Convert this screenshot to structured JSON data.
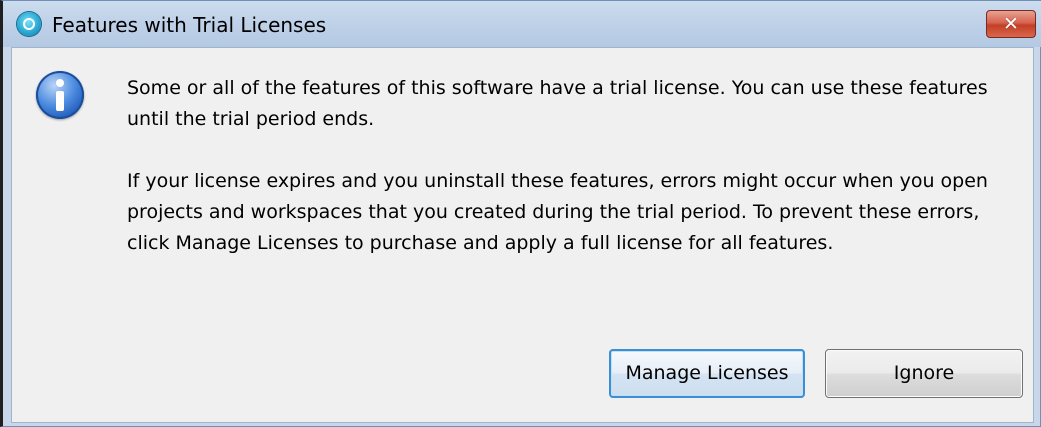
{
  "window": {
    "title": "Features with Trial Licenses",
    "close_label": "✕"
  },
  "message": {
    "paragraph1": "Some or all of the features of this software have a trial license.  You can use these features until the trial period ends.",
    "paragraph2": "If your license expires and you uninstall these features, errors might occur when you open projects and workspaces that you created during the trial period.  To prevent these errors, click Manage Licenses to purchase and apply a full license for all features."
  },
  "buttons": {
    "manage_label": "Manage Licenses",
    "ignore_label": "Ignore"
  },
  "icons": {
    "app": "app-logo-icon",
    "info": "info-icon",
    "close": "close-icon"
  },
  "colors": {
    "titlebar": "#bed1e8",
    "close_button": "#c33f26",
    "content_background": "#f0f0f0",
    "default_button_border": "#3c8fd3"
  }
}
